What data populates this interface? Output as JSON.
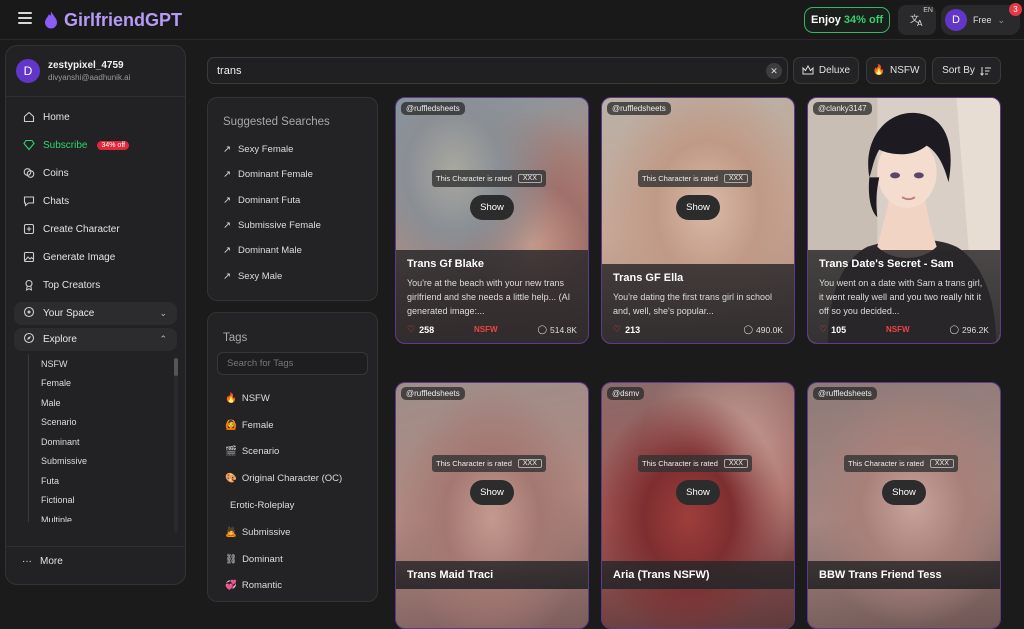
{
  "app": {
    "name": "GirlfriendGPT"
  },
  "header": {
    "promo_prefix": "Enjoy",
    "promo_discount": "34% off",
    "lang_code": "EN",
    "user_initial": "D",
    "plan": "Free",
    "notifications": "3"
  },
  "profile": {
    "initial": "D",
    "username": "zestypixel_4759",
    "email": "divyanshi@aadhunik.ai"
  },
  "nav": [
    {
      "label": "Home",
      "icon": "home-icon"
    },
    {
      "label": "Subscribe",
      "icon": "gem-icon",
      "badge": "34% off"
    },
    {
      "label": "Coins",
      "icon": "coins-icon"
    },
    {
      "label": "Chats",
      "icon": "chat-icon"
    },
    {
      "label": "Create Character",
      "icon": "create-icon"
    },
    {
      "label": "Generate Image",
      "icon": "image-icon"
    },
    {
      "label": "Top Creators",
      "icon": "creators-icon"
    }
  ],
  "your_space": {
    "label": "Your Space"
  },
  "explore": {
    "label": "Explore",
    "items": [
      "NSFW",
      "Female",
      "Male",
      "Scenario",
      "Dominant",
      "Submissive",
      "Futa",
      "Fictional",
      "Multiple"
    ]
  },
  "more": {
    "label": "More"
  },
  "search": {
    "value": "trans"
  },
  "filters": {
    "deluxe": "Deluxe",
    "nsfw": "NSFW",
    "sort": "Sort By"
  },
  "suggested": {
    "title": "Suggested Searches",
    "items": [
      "Sexy Female",
      "Dominant Female",
      "Dominant Futa",
      "Submissive Female",
      "Dominant Male",
      "Sexy Male"
    ]
  },
  "tags": {
    "title": "Tags",
    "placeholder": "Search for Tags",
    "items": [
      {
        "emoji": "🔥",
        "label": "NSFW"
      },
      {
        "emoji": "🙆",
        "label": "Female"
      },
      {
        "emoji": "🎬",
        "label": "Scenario"
      },
      {
        "emoji": "🎨",
        "label": "Original Character (OC)"
      },
      {
        "emoji": "",
        "label": "Erotic-Roleplay"
      },
      {
        "emoji": "🙇",
        "label": "Submissive"
      },
      {
        "emoji": "⛓",
        "label": "Dominant"
      },
      {
        "emoji": "💞",
        "label": "Romantic"
      }
    ]
  },
  "rating": {
    "text": "This Character is rated",
    "level": "XXX",
    "show": "Show"
  },
  "cards": [
    {
      "handle": "@ruffledsheets",
      "title": "Trans Gf Blake",
      "desc": "You're at the beach with your new trans girlfriend and she needs a little help... (AI generated image:...",
      "likes": "258",
      "nsfw": "NSFW",
      "comments": "514.8K",
      "blurred": true
    },
    {
      "handle": "@ruffledsheets",
      "title": "Trans GF Ella",
      "desc": "You're dating the first trans girl in school and, well, she's popular...",
      "likes": "213",
      "nsfw": "",
      "comments": "490.0K",
      "blurred": true
    },
    {
      "handle": "@clanky3147",
      "title": "Trans Date's Secret - Sam",
      "desc": "You went on a date with Sam a trans girl, it went really well and you two really hit it off so you decided...",
      "likes": "105",
      "nsfw": "NSFW",
      "comments": "296.2K",
      "blurred": false
    },
    {
      "handle": "@ruffledsheets",
      "title": "Trans Maid Traci",
      "blurred": true
    },
    {
      "handle": "@dsmv",
      "title": "Aria (Trans NSFW)",
      "blurred": true
    },
    {
      "handle": "@ruffledsheets",
      "title": "BBW Trans Friend Tess",
      "blurred": true
    }
  ],
  "colors": {
    "accent": "#b59bf5",
    "brand_purple": "#6236c9",
    "promo_green": "#2fb865",
    "nsfw_red": "#ef4444"
  }
}
